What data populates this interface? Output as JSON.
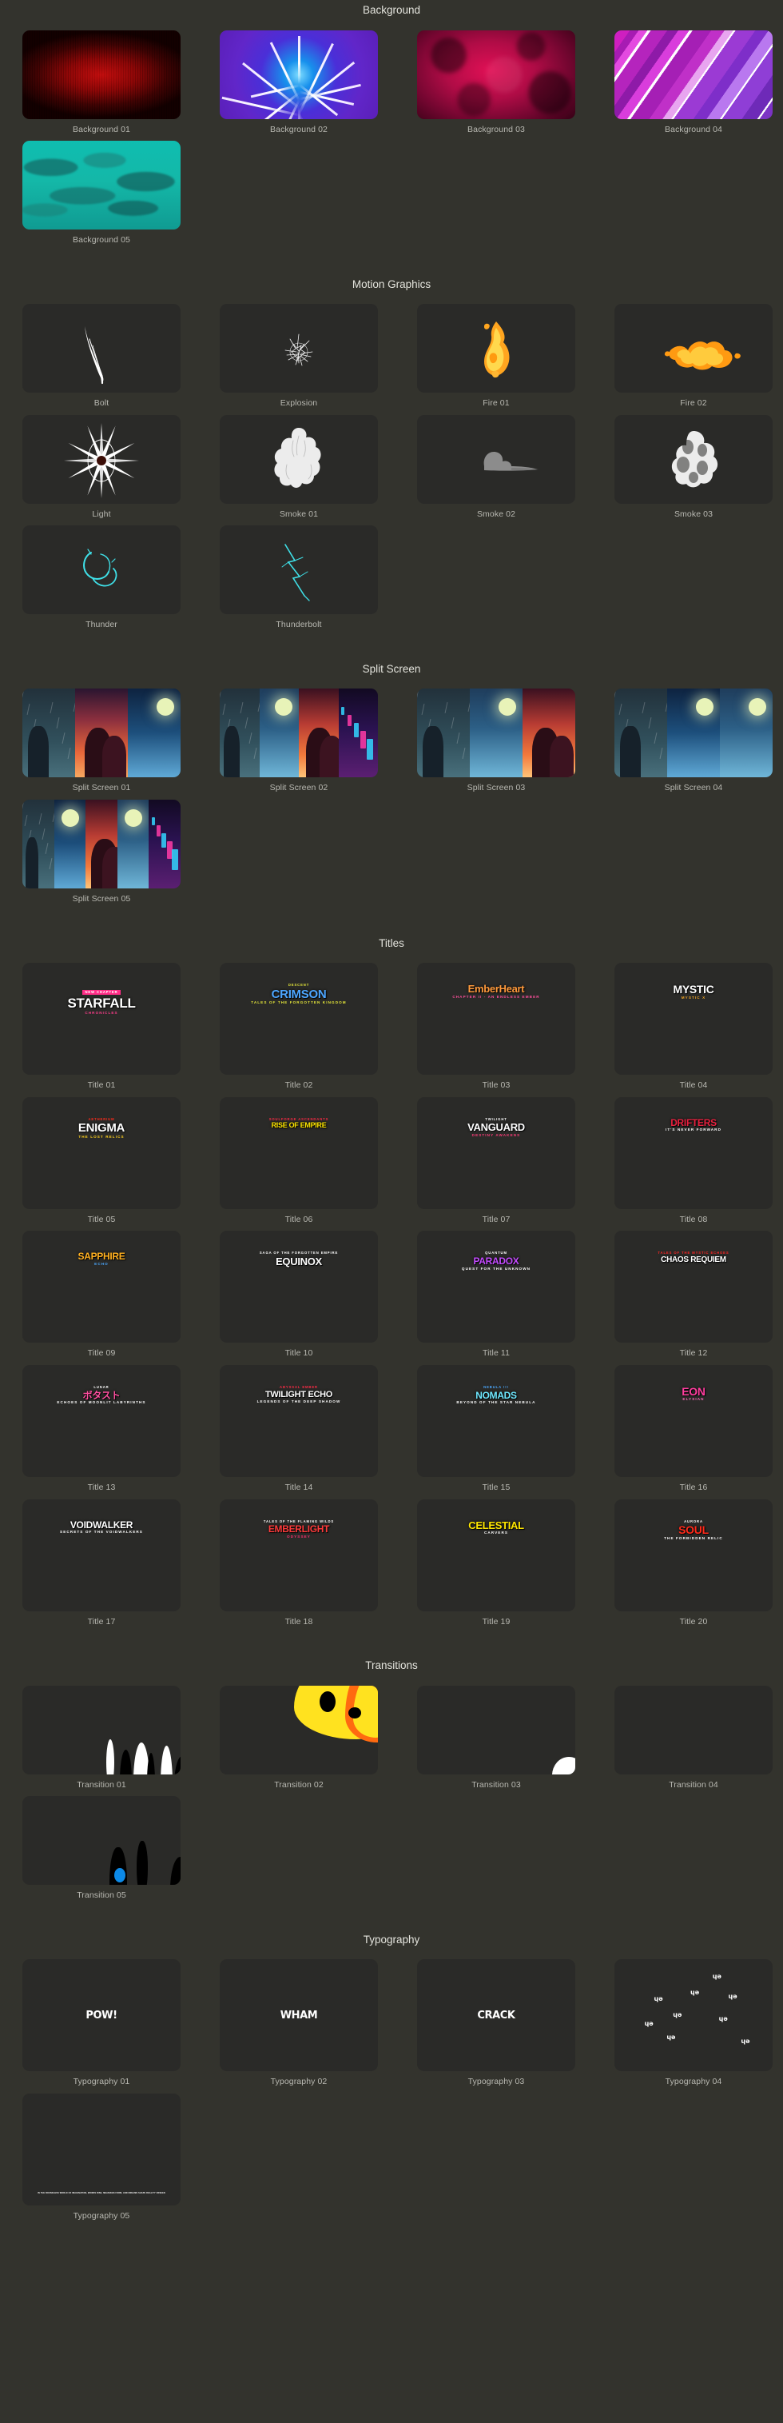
{
  "sections": [
    {
      "id": "background",
      "title": "Background",
      "items": [
        {
          "label": "Background 01",
          "art": "bg01"
        },
        {
          "label": "Background 02",
          "art": "bg02"
        },
        {
          "label": "Background 03",
          "art": "bg03"
        },
        {
          "label": "Background 04",
          "art": "bg04"
        },
        {
          "label": "Background 05",
          "art": "bg05"
        }
      ]
    },
    {
      "id": "motion-graphics",
      "title": "Motion Graphics",
      "items": [
        {
          "label": "Bolt",
          "art": "mg-bolt"
        },
        {
          "label": "Explosion",
          "art": "mg-explosion"
        },
        {
          "label": "Fire 01",
          "art": "mg-fire01"
        },
        {
          "label": "Fire 02",
          "art": "mg-fire02"
        },
        {
          "label": "Light",
          "art": "mg-light"
        },
        {
          "label": "Smoke 01",
          "art": "mg-smoke01"
        },
        {
          "label": "Smoke 02",
          "art": "mg-smoke02"
        },
        {
          "label": "Smoke 03",
          "art": "mg-smoke03"
        },
        {
          "label": "Thunder",
          "art": "mg-thunder"
        },
        {
          "label": "Thunderbolt",
          "art": "mg-thunderbolt"
        }
      ]
    },
    {
      "id": "split-screen",
      "title": "Split Screen",
      "items": [
        {
          "label": "Split Screen 01",
          "art": "ss01"
        },
        {
          "label": "Split Screen 02",
          "art": "ss02"
        },
        {
          "label": "Split Screen 03",
          "art": "ss03"
        },
        {
          "label": "Split Screen 04",
          "art": "ss04"
        },
        {
          "label": "Split Screen 05",
          "art": "ss05"
        }
      ]
    },
    {
      "id": "titles",
      "title": "Titles",
      "items": [
        {
          "label": "Title 01",
          "logo": {
            "kick": "NEW CHAPTER",
            "main": "STARFALL",
            "sub": "CHRONICLES",
            "main_color": "#ffffff",
            "kick_color": "#ffffff",
            "sub_color": "#ff3d8b",
            "kick_bg": "#ff2d87",
            "size": 17
          }
        },
        {
          "label": "Title 02",
          "logo": {
            "kick": "DESCENT",
            "main": "CRIMSON",
            "sub": "TALES OF THE FORGOTTEN KINGDOM",
            "main_color": "#4da6ff",
            "kick_color": "#e8ea3a",
            "sub_color": "#e8ea3a",
            "size": 15
          }
        },
        {
          "label": "Title 03",
          "logo": {
            "kick": "",
            "main": "EmberHeart",
            "sub": "CHAPTER II - AN ENDLESS EMBER",
            "main_color": "#ff9a3c",
            "sub_color": "#ff4f9c",
            "size": 13
          }
        },
        {
          "label": "Title 04",
          "logo": {
            "kick": "",
            "main": "MYSTIC",
            "sub": "MYSTIC X",
            "main_color": "#ffffff",
            "sub_color": "#f5a623",
            "size": 14
          }
        },
        {
          "label": "Title 05",
          "logo": {
            "kick": "AETHERIUM",
            "main": "ENIGMA",
            "sub": "THE LOST RELICS",
            "main_color": "#ffffff",
            "kick_color": "#ff2a1a",
            "sub_color": "#ffd21e",
            "size": 15
          }
        },
        {
          "label": "Title 06",
          "logo": {
            "kick": "SOULFORGE ASCENDANTS",
            "main": "RISE OF EMPIRE",
            "sub": "",
            "main_color": "#ffe600",
            "kick_color": "#ff2a45",
            "size": 9
          }
        },
        {
          "label": "Title 07",
          "logo": {
            "kick": "TWILIGHT",
            "main": "VANGUARD",
            "sub": "DESTINY AWAKENS",
            "main_color": "#ffffff",
            "kick_color": "#ffffff",
            "sub_color": "#ff3d7a",
            "size": 13
          }
        },
        {
          "label": "Title 08",
          "logo": {
            "kick": "",
            "main": "DRIFTERS",
            "sub": "IT'S NEVER FORWARD",
            "main_color": "#e8213f",
            "sub_color": "#ffffff",
            "size": 12
          }
        },
        {
          "label": "Title 09",
          "logo": {
            "kick": "",
            "main": "SAPPHIRE",
            "sub": "ECHO",
            "main_color": "#ffb020",
            "sub_color": "#4aa8ff",
            "size": 12
          }
        },
        {
          "label": "Title 10",
          "logo": {
            "kick": "SAGA OF THE FORGOTTEN EMPIRE",
            "main": "EQUINOX",
            "sub": "",
            "main_color": "#ffffff",
            "kick_color": "#ffffff",
            "size": 13
          }
        },
        {
          "label": "Title 11",
          "logo": {
            "kick": "QUANTUM",
            "main": "PARADOX",
            "sub": "QUEST FOR THE UNKNOWN",
            "main_color": "#c44bff",
            "kick_color": "#ffffff",
            "sub_color": "#ffffff",
            "size": 12
          }
        },
        {
          "label": "Title 12",
          "logo": {
            "kick": "TALES OF THE MYSTIC ECHOES",
            "main": "CHAOS REQUIEM",
            "sub": "",
            "main_color": "#ffffff",
            "kick_color": "#ff2424",
            "size": 10
          }
        },
        {
          "label": "Title 13",
          "logo": {
            "kick": "LUNAR",
            "main": "ボタスト",
            "sub": "ECHOES OF MOONLIT LABYRINTHS",
            "main_color": "#ff4fa0",
            "kick_color": "#ffffff",
            "sub_color": "#ffffff",
            "size": 12
          }
        },
        {
          "label": "Title 14",
          "logo": {
            "kick": "ABYSSAL EMBER",
            "main": "TWILIGHT ECHO",
            "sub": "LEGENDS OF THE DEEP SHADOW",
            "main_color": "#ffffff",
            "kick_color": "#ff2a45",
            "sub_color": "#ffffff",
            "size": 11
          }
        },
        {
          "label": "Title 15",
          "logo": {
            "kick": "NEBULA !!!",
            "main": "NOMADS",
            "sub": "BEYOND OF THE STAR NEBULA",
            "main_color": "#6fe8ff",
            "kick_color": "#4aa8ff",
            "sub_color": "#ffffff",
            "size": 12
          }
        },
        {
          "label": "Title 16",
          "logo": {
            "kick": "",
            "main": "EON",
            "sub": "ELYSIAN",
            "main_color": "#ff3d9e",
            "sub_color": "#ff69bb",
            "size": 14
          }
        },
        {
          "label": "Title 17",
          "logo": {
            "kick": "",
            "main": "VOIDWALKER",
            "sub": "SECRETS OF THE VOIDWALKERS",
            "main_color": "#ffffff",
            "sub_color": "#ffffff",
            "size": 12
          }
        },
        {
          "label": "Title 18",
          "logo": {
            "kick": "TALES OF THE FLAMING WILDS",
            "main": "EMBERLIGHT",
            "sub": "ODYSSEY",
            "main_color": "#ff3b3b",
            "kick_color": "#ffffff",
            "sub_color": "#ff2f6e",
            "size": 12
          }
        },
        {
          "label": "Title 19",
          "logo": {
            "kick": "",
            "main": "CELESTIAL",
            "sub": "CARVERS",
            "main_color": "#ffe600",
            "sub_color": "#ffffff",
            "size": 13
          }
        },
        {
          "label": "Title 20",
          "logo": {
            "kick": "AURORA",
            "main": "SOUL",
            "sub": "THE FORBIDDEN RELIC",
            "main_color": "#ff2a1a",
            "kick_color": "#ffffff",
            "sub_color": "#ffffff",
            "size": 14
          }
        }
      ]
    },
    {
      "id": "transitions",
      "title": "Transitions",
      "items": [
        {
          "label": "Transition 01",
          "art": "tr01"
        },
        {
          "label": "Transition 02",
          "art": "tr02"
        },
        {
          "label": "Transition 03",
          "art": "tr03"
        },
        {
          "label": "Transition 04",
          "art": "tr04"
        },
        {
          "label": "Transition 05",
          "art": "tr05"
        }
      ]
    },
    {
      "id": "typography",
      "title": "Typography",
      "items": [
        {
          "label": "Typography 01",
          "word": "POW!"
        },
        {
          "label": "Typography 02",
          "word": "WHAM"
        },
        {
          "label": "Typography 03",
          "word": "CRACK"
        },
        {
          "label": "Typography 04",
          "word": ""
        },
        {
          "label": "Typography 05",
          "word": "",
          "line": "IN THE BOUNDLESS WORLD OF IMAGINATION, WORDS RISE, MEANINGS FORM, AND DREAMS SHAPE REALITY UNSEEN"
        }
      ]
    }
  ],
  "theme": {
    "page_bg": "#33332d",
    "card_bg": "#2a2a28",
    "title_color": "#e3e3dc",
    "caption_color": "#b9b9b2"
  }
}
